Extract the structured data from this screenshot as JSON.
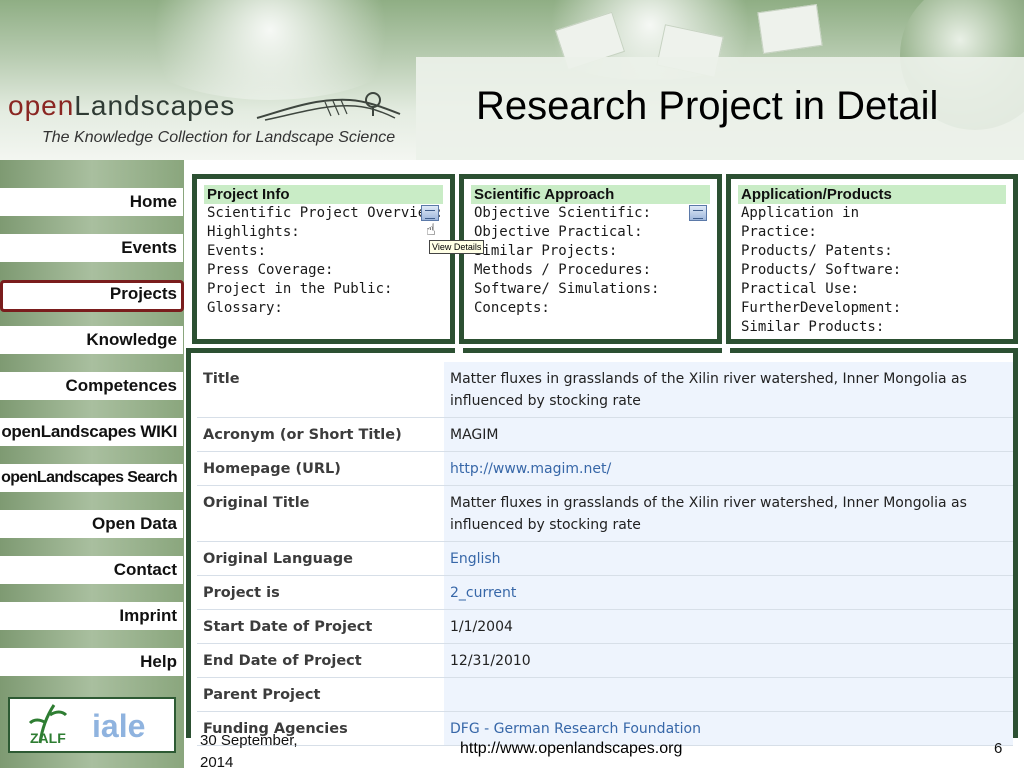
{
  "slide": {
    "title": "Research Project in Detail",
    "date": "30 September, 2014",
    "url": "http://www.openlandscapes.org",
    "page_number": "6"
  },
  "logo": {
    "name_open": "open",
    "name_rest": "Landscapes",
    "tagline": "The Knowledge Collection for Landscape Science"
  },
  "nav": {
    "items": [
      {
        "label": "Home"
      },
      {
        "label": "Events"
      },
      {
        "label": "Projects"
      },
      {
        "label": "Knowledge"
      },
      {
        "label": "Competences"
      },
      {
        "label": "openLandscapes WIKI"
      },
      {
        "label": "openLandscapes Search"
      },
      {
        "label": "Open Data"
      },
      {
        "label": "Contact"
      },
      {
        "label": "Imprint"
      },
      {
        "label": "Help"
      }
    ],
    "active": "Projects"
  },
  "boxes": {
    "project_info": {
      "heading": "Project Info",
      "lines": [
        "Scientific Project Overview:",
        "Highlights:",
        "Events:",
        "Press Coverage:",
        "Project in the Public:",
        "Glossary:"
      ]
    },
    "scientific_approach": {
      "heading": "Scientific Approach",
      "lines": [
        "Objective Scientific:",
        "Objective Practical:",
        "Similar Projects:",
        "Methods / Procedures:",
        "Software/ Simulations:",
        "Concepts:"
      ]
    },
    "application_products": {
      "heading": "Application/Products",
      "lines": [
        "Application in",
        "Practice:",
        "Products/ Patents:",
        "Products/ Software:",
        "Practical Use:",
        "FurtherDevelopment:",
        "Similar Products:"
      ]
    }
  },
  "tooltip": {
    "text": "View Details"
  },
  "details": {
    "rows": [
      {
        "label": "Title",
        "value": "Matter fluxes in grasslands of the Xilin river watershed, Inner Mongolia as influenced by stocking rate"
      },
      {
        "label": "Acronym (or Short Title)",
        "value": "MAGIM"
      },
      {
        "label": "Homepage (URL)",
        "value": "http://www.magim.net/"
      },
      {
        "label": "Original Title",
        "value": "Matter fluxes in grasslands of the Xilin river watershed, Inner Mongolia as influenced by stocking rate"
      },
      {
        "label": "Original Language",
        "value": "English"
      },
      {
        "label": "Project is",
        "value": "2_current"
      },
      {
        "label": "Start Date of Project",
        "value": "1/1/2004"
      },
      {
        "label": "End Date of Project",
        "value": "12/31/2010"
      },
      {
        "label": "Parent Project",
        "value": ""
      },
      {
        "label": "Funding Agencies",
        "value": "DFG - German Research Foundation"
      }
    ]
  },
  "partner_logos": {
    "zalf": "ZALF",
    "iale": "iale"
  },
  "colors": {
    "frame_green": "#2c5032",
    "box_heading_bg": "#c9ecc6",
    "active_nav_border": "#7a1d1d",
    "link_blue": "#3767a8",
    "value_bg": "#eef4fd"
  }
}
